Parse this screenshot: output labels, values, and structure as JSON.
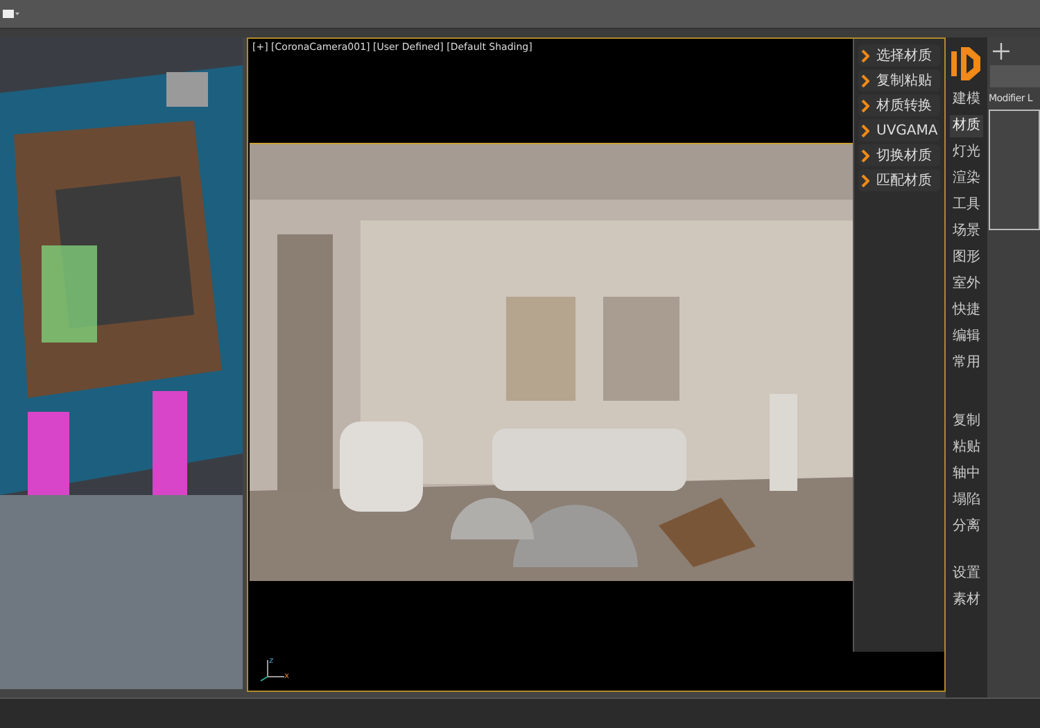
{
  "viewport": {
    "label": "[+] [CoronaCamera001] [User Defined] [Default Shading]",
    "axis_labels": [
      "z",
      "x"
    ]
  },
  "plugin_menu": [
    {
      "label": "选择材质"
    },
    {
      "label": "复制粘贴"
    },
    {
      "label": "材质转换"
    },
    {
      "label": "UVGAMA"
    },
    {
      "label": "切换材质"
    },
    {
      "label": "匹配材质"
    }
  ],
  "sidebar": {
    "groups": [
      {
        "items": [
          {
            "label": "建模",
            "selected": false
          },
          {
            "label": "材质",
            "selected": true
          },
          {
            "label": "灯光",
            "selected": false
          },
          {
            "label": "渲染",
            "selected": false
          },
          {
            "label": "工具",
            "selected": false
          },
          {
            "label": "场景",
            "selected": false
          },
          {
            "label": "图形",
            "selected": false
          },
          {
            "label": "室外",
            "selected": false
          },
          {
            "label": "快捷",
            "selected": false
          },
          {
            "label": "编辑",
            "selected": false
          },
          {
            "label": "常用",
            "selected": false
          }
        ]
      },
      {
        "items": [
          {
            "label": "复制",
            "selected": false
          },
          {
            "label": "粘贴",
            "selected": false
          },
          {
            "label": "轴中",
            "selected": false
          },
          {
            "label": "塌陷",
            "selected": false
          },
          {
            "label": "分离",
            "selected": false
          }
        ]
      },
      {
        "items": [
          {
            "label": "设置",
            "selected": false
          },
          {
            "label": "素材",
            "selected": false
          }
        ]
      }
    ]
  },
  "command_panel": {
    "modifier_list": "Modifier L"
  }
}
